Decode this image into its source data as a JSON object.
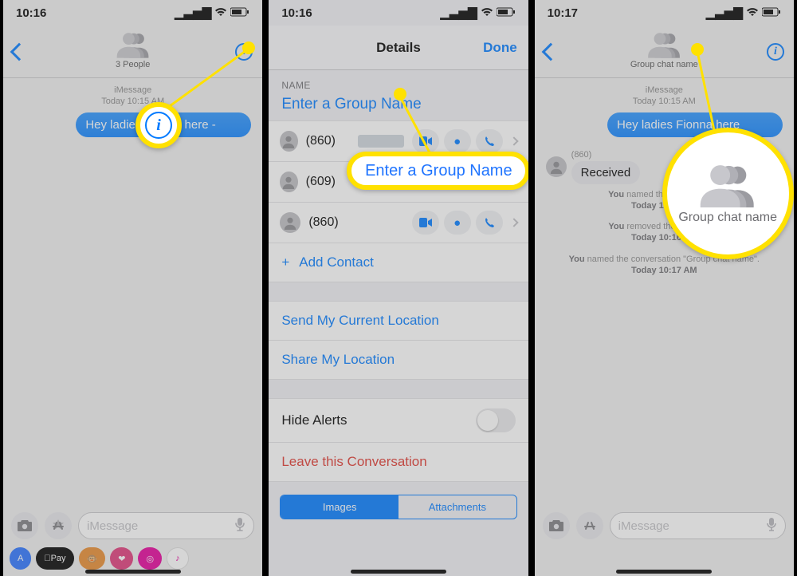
{
  "phone1": {
    "time": "10:16",
    "header_subtitle": "3 People",
    "meta_type": "iMessage",
    "meta_time": "Today 10:15 AM",
    "bubble": "Hey ladies Fionna here -",
    "input_placeholder": "iMessage",
    "app_strip": {
      "apple_pay": "Pay"
    }
  },
  "phone2": {
    "time": "10:16",
    "title": "Details",
    "done": "Done",
    "name_section": "NAME",
    "name_placeholder": "Enter a Group Name",
    "contacts": [
      {
        "num": "(860)"
      },
      {
        "num": "(609)"
      },
      {
        "num": "(860)"
      }
    ],
    "add_contact": "Add Contact",
    "send_location": "Send My Current Location",
    "share_location": "Share My Location",
    "hide_alerts": "Hide Alerts",
    "leave": "Leave this Conversation",
    "seg_images": "Images",
    "seg_attachments": "Attachments",
    "callout_label": "Enter a Group Name"
  },
  "phone3": {
    "time": "10:17",
    "header_subtitle": "Group chat name",
    "meta_type": "iMessage",
    "meta_time": "Today 10:15 AM",
    "bubble": "Hey ladies Fionna here",
    "sender": "(860)",
    "received": "Received",
    "sys1_a": "You",
    "sys1_b": " named the conversation",
    "sys1_time": "Today 10:16 AM",
    "sys2_a": "You",
    "sys2_b": " removed the name from",
    "sys2_time": "Today 10:16 AM",
    "sys3_a": "You",
    "sys3_b": " named the conversation \"Group chat name\".",
    "sys3_time": "Today 10:17 AM",
    "input_placeholder": "iMessage",
    "callout_label": "Group chat name"
  }
}
